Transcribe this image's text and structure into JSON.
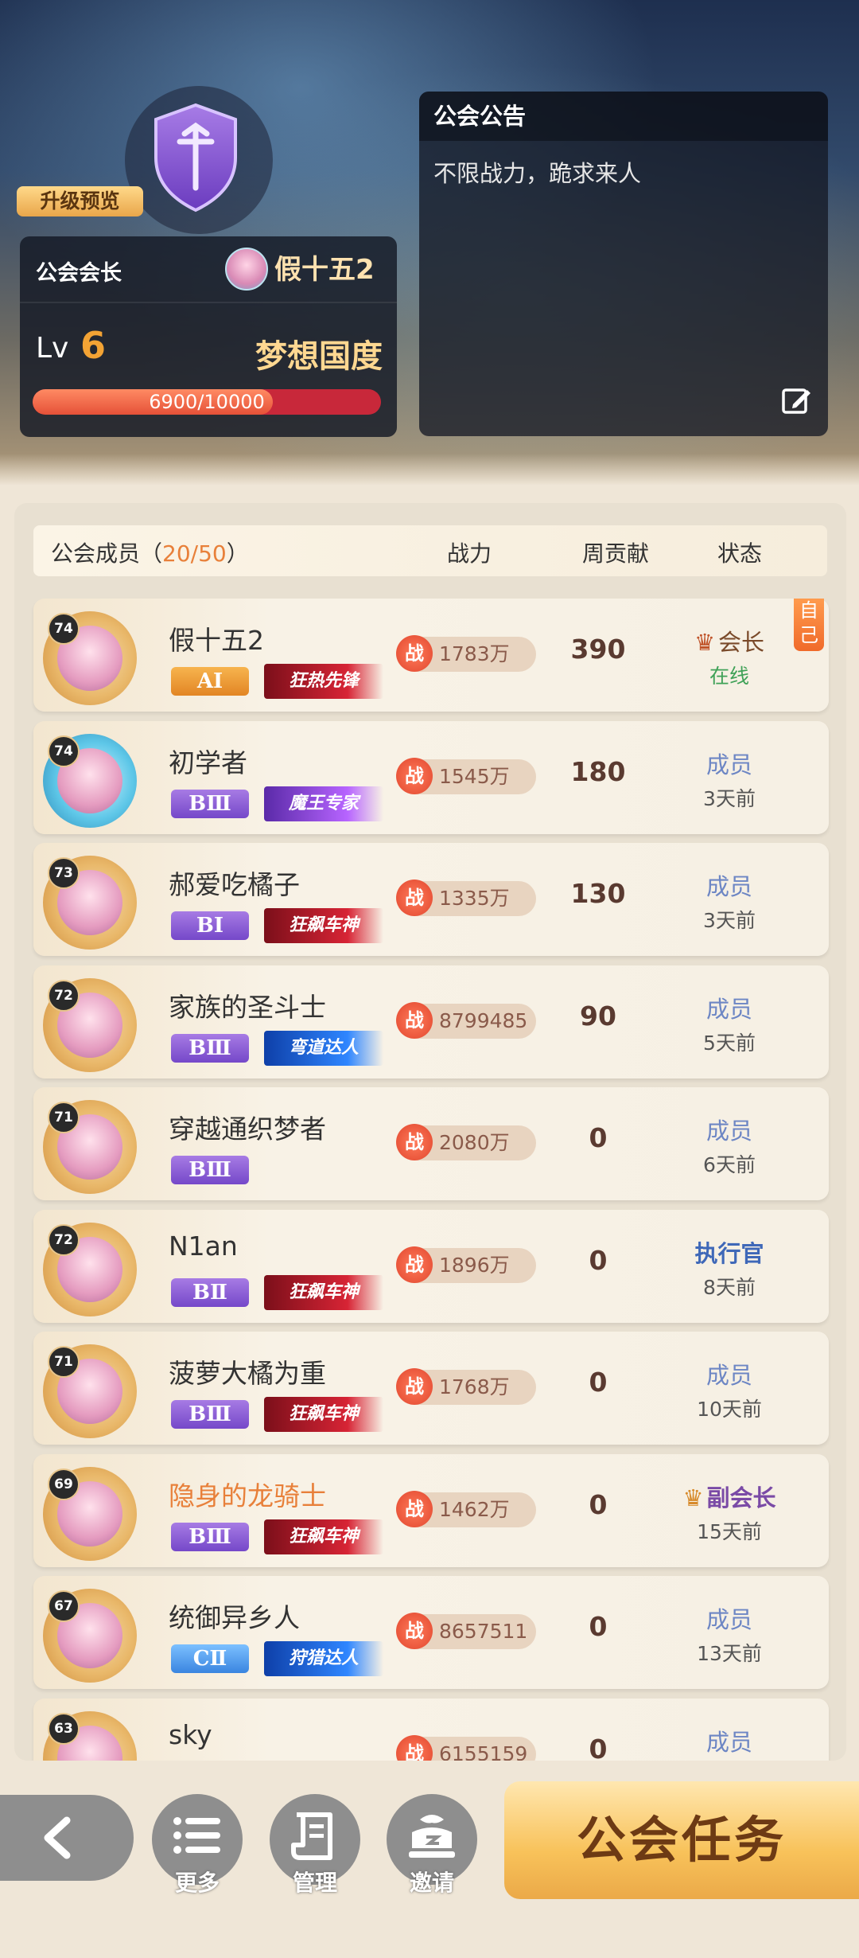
{
  "guild": {
    "upgrade_preview": "升级预览",
    "leader_label": "公会会长",
    "leader_name": "假十五2",
    "lv_label": "Lv",
    "level": "6",
    "name": "梦想国度",
    "exp_text": "6900/10000",
    "exp_fraction": 0.69
  },
  "notice": {
    "title": "公会公告",
    "text": "不限战力，跪求来人"
  },
  "member_header": {
    "label": "公会成员",
    "count": "20/50",
    "col_power": "战力",
    "col_contrib": "周贡献",
    "col_status": "状态"
  },
  "power_icon": "战",
  "members": [
    {
      "level": "74",
      "name": "假十五2",
      "rank": "AⅠ",
      "rank_color": "gold",
      "title": "狂热先锋",
      "title_color": "red",
      "power": "1783万",
      "contrib": "390",
      "role": "会长",
      "role_type": "leader",
      "time": "在线",
      "online": true,
      "self": "自己"
    },
    {
      "level": "74",
      "name": "初学者",
      "rank": "BⅢ",
      "rank_color": "purple",
      "title": "魔王专家",
      "title_color": "violet",
      "power": "1545万",
      "contrib": "180",
      "role": "成员",
      "role_type": "member",
      "time": "3天前"
    },
    {
      "level": "73",
      "name": "郝爱吃橘子",
      "rank": "BⅠ",
      "rank_color": "purple",
      "title": "狂飙车神",
      "title_color": "red",
      "power": "1335万",
      "contrib": "130",
      "role": "成员",
      "role_type": "member",
      "time": "3天前"
    },
    {
      "level": "72",
      "name": "家族的圣斗士",
      "rank": "BⅢ",
      "rank_color": "purple",
      "title": "弯道达人",
      "title_color": "azure",
      "power": "8799485",
      "contrib": "90",
      "role": "成员",
      "role_type": "member",
      "time": "5天前"
    },
    {
      "level": "71",
      "name": "穿越通织梦者",
      "rank": "BⅢ",
      "rank_color": "purple",
      "title": "",
      "title_color": "",
      "power": "2080万",
      "contrib": "0",
      "role": "成员",
      "role_type": "member",
      "time": "6天前"
    },
    {
      "level": "72",
      "name": "N1an",
      "rank": "BⅡ",
      "rank_color": "purple",
      "title": "狂飙车神",
      "title_color": "red",
      "power": "1896万",
      "contrib": "0",
      "role": "执行官",
      "role_type": "exec",
      "time": "8天前"
    },
    {
      "level": "71",
      "name": "菠萝大橘为重",
      "rank": "BⅢ",
      "rank_color": "purple",
      "title": "狂飙车神",
      "title_color": "red",
      "power": "1768万",
      "contrib": "0",
      "role": "成员",
      "role_type": "member",
      "time": "10天前"
    },
    {
      "level": "69",
      "name": "隐身的龙骑士",
      "rank": "BⅢ",
      "rank_color": "purple",
      "title": "狂飙车神",
      "title_color": "red",
      "power": "1462万",
      "contrib": "0",
      "role": "副会长",
      "role_type": "vice",
      "time": "15天前"
    },
    {
      "level": "67",
      "name": "统御异乡人",
      "rank": "CⅡ",
      "rank_color": "blue",
      "title": "狩猎达人",
      "title_color": "azure",
      "power": "8657511",
      "contrib": "0",
      "role": "成员",
      "role_type": "member",
      "time": "13天前"
    },
    {
      "level": "63",
      "name": "sky",
      "rank": "",
      "rank_color": "",
      "title": "",
      "title_color": "",
      "power": "6155159",
      "contrib": "0",
      "role": "成员",
      "role_type": "member",
      "time": ""
    }
  ],
  "bottom": {
    "more": "更多",
    "manage": "管理",
    "invite": "邀请",
    "task": "公会任务"
  }
}
